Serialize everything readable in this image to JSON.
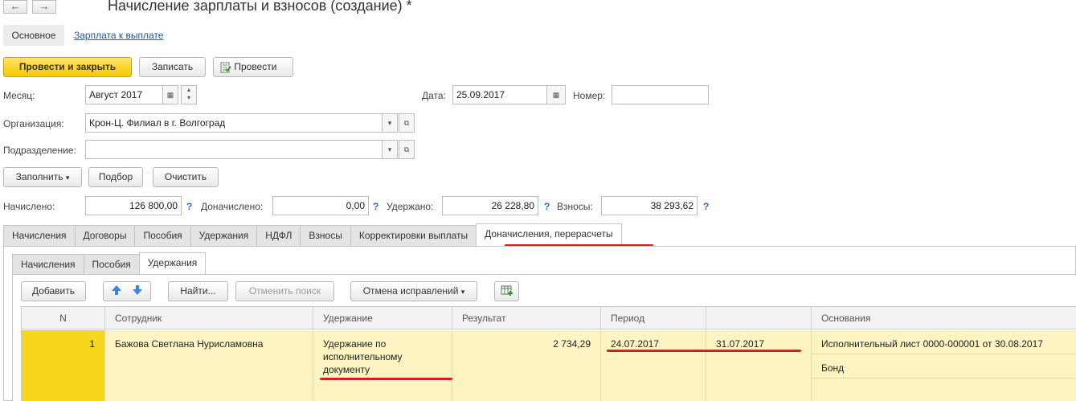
{
  "window": {
    "title": "Начисление зарплаты и взносов (создание) *",
    "nav_back": "←",
    "nav_forward": "→"
  },
  "form_tabs": {
    "active": "Основное",
    "link": "Зарплата к выплате"
  },
  "toolbar": {
    "post_close": "Провести и закрыть",
    "save": "Записать",
    "post": "Провести"
  },
  "fields": {
    "month_label": "Месяц:",
    "month_value": "Август 2017",
    "date_label": "Дата:",
    "date_value": "25.09.2017",
    "number_label": "Номер:",
    "number_value": "",
    "org_label": "Организация:",
    "org_value": "Крон-Ц. Филиал в г. Волгоград",
    "dept_label": "Подразделение:",
    "dept_value": ""
  },
  "actions": {
    "fill": "Заполнить",
    "select": "Подбор",
    "clear": "Очистить"
  },
  "totals": {
    "accrued_label": "Начислено:",
    "accrued_value": "126 800,00",
    "additional_label": "Доначислено:",
    "additional_value": "0,00",
    "withheld_label": "Удержано:",
    "withheld_value": "26 228,80",
    "contrib_label": "Взносы:",
    "contrib_value": "38 293,62",
    "help": "?"
  },
  "main_tabs": [
    "Начисления",
    "Договоры",
    "Пособия",
    "Удержания",
    "НДФЛ",
    "Взносы",
    "Корректировки выплаты",
    "Доначисления, перерасчеты"
  ],
  "sub_tabs": [
    "Начисления",
    "Пособия",
    "Удержания"
  ],
  "table_toolbar": {
    "add": "Добавить",
    "find": "Найти...",
    "cancel_search": "Отменить поиск",
    "cancel_corrections": "Отмена исправлений"
  },
  "table": {
    "columns": [
      "N",
      "Сотрудник",
      "Удержание",
      "Результат",
      "Период",
      "",
      "Основания"
    ],
    "rows": [
      {
        "n": "1",
        "employee": "Бажова Светлана Нурисламовна",
        "withholding": "Удержание по исполнительному документу",
        "result": "2 734,29",
        "period_start": "24.07.2017",
        "period_end": "31.07.2017",
        "basis": "Исполнительный лист 0000-000001 от 30.08.2017",
        "basis_extra": "Бонд"
      }
    ]
  },
  "colors": {
    "primary_button": "#f5c900",
    "selected_row": "#fbf4c2",
    "row_number_cell": "#f7d71c",
    "annotation": "#e01b1b",
    "link": "#1c5a9c"
  }
}
